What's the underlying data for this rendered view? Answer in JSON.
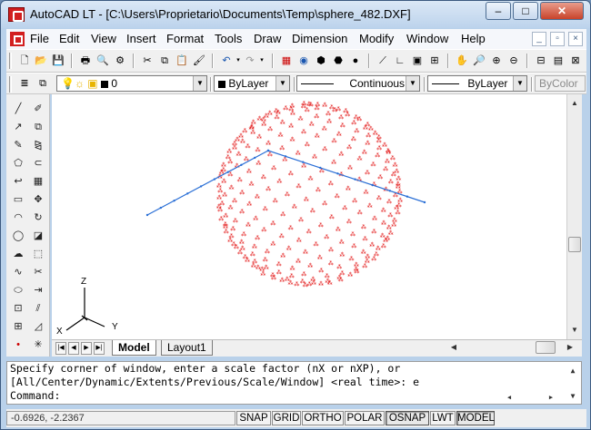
{
  "titlebar": {
    "title": "AutoCAD LT - [C:\\Users\\Proprietario\\Documents\\Temp\\sphere_482.DXF]",
    "minimize": "–",
    "maximize": "□",
    "close": "✕"
  },
  "menu": {
    "items": [
      "File",
      "Edit",
      "View",
      "Insert",
      "Format",
      "Tools",
      "Draw",
      "Dimension",
      "Modify",
      "Window",
      "Help"
    ],
    "doc_minimize": "_",
    "doc_restore": "▫",
    "doc_close": "×"
  },
  "toolbar_standard": {
    "icons": [
      "new-icon",
      "open-icon",
      "save-icon",
      "plot-icon",
      "plot-preview-icon",
      "publish-icon",
      "cut-icon",
      "copy-icon",
      "paste-icon",
      "match-properties-icon",
      "undo-icon",
      "redo-icon",
      "design-center-icon",
      "properties-icon",
      "tool-palettes-icon",
      "markup-icon",
      "pan-icon",
      "zoom-realtime-icon",
      "zoom-window-icon",
      "zoom-previous-icon",
      "distance-icon",
      "locate-point-icon",
      "aerial-view-icon",
      "table-icon",
      "block-icon"
    ]
  },
  "layers": {
    "layer_value": "0",
    "color_value": "ByLayer",
    "linetype_value": "Continuous",
    "lineweight_value": "ByLayer",
    "plotstyle_value": "ByColor",
    "color_swatch": "#000000"
  },
  "draw_toolbar": {
    "left_col": [
      "line-icon",
      "construction-line-icon",
      "polyline-icon",
      "polygon-icon",
      "polygon2-icon",
      "rectangle-icon",
      "arc-icon",
      "circle-icon",
      "revcloud-icon",
      "spline-icon",
      "ellipse-icon",
      "insert-block-icon",
      "make-block-icon",
      "point-icon"
    ],
    "right_col": [
      "erase-icon",
      "copy-object-icon",
      "mirror-icon",
      "offset-icon",
      "array-icon",
      "move-icon",
      "rotate-icon",
      "scale-icon",
      "stretch-icon",
      "trim-icon",
      "extend-icon",
      "break-icon",
      "chamfer-icon",
      "explode-icon"
    ]
  },
  "ucs": {
    "x_label": "X",
    "y_label": "Y",
    "z_label": "Z"
  },
  "tabs": {
    "model": "Model",
    "layout1": "Layout1"
  },
  "command": {
    "line1": "Specify corner of window, enter a scale factor (nX or nXP), or",
    "line2": "[All/Center/Dynamic/Extents/Previous/Scale/Window] <real time>: e",
    "prompt": "Command:"
  },
  "status": {
    "coordinates": "-0.6926, -2.2367",
    "buttons": [
      "SNAP",
      "GRID",
      "ORTHO",
      "POLAR",
      "OSNAP",
      "LWT",
      "MODEL"
    ],
    "active": [
      "OSNAP",
      "MODEL"
    ]
  },
  "colors": {
    "sphere_points": "#e00000",
    "polyline": "#2a6fd6"
  }
}
